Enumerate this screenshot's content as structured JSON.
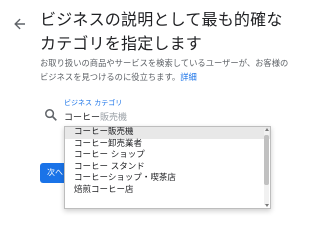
{
  "header": {
    "title": "ビジネスの説明として最も的確なカテゴリを指定します",
    "description": "お取り扱いの商品やサービスを検索しているユーザーが、お客様のビジネスを見つけるのに役立ちます。",
    "details_link": "詳細"
  },
  "category_field": {
    "label": "ビジネス カテゴリ",
    "typed_value": "コーヒー",
    "autocomplete_hint": "販売機"
  },
  "next_button": {
    "label": "次へ"
  },
  "dropdown": {
    "items": [
      "コーヒー販売機",
      "コーヒー卸売業者",
      "コーヒー ショップ",
      "コーヒー スタンド",
      "コーヒーショップ・喫茶店",
      "焙煎コーヒー店"
    ],
    "highlighted_index": 0
  },
  "colors": {
    "accent": "#1a73e8",
    "text": "#202124",
    "secondary_text": "#5f6368"
  }
}
